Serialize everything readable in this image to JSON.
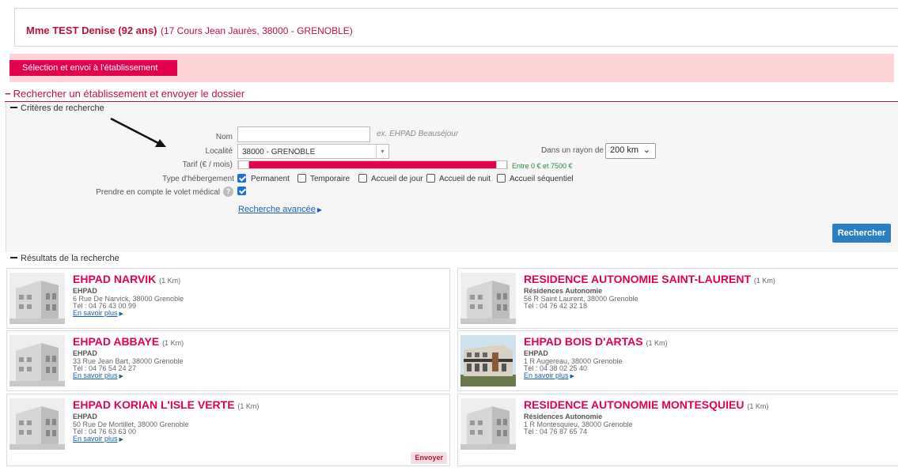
{
  "patient": {
    "name": "Mme TEST Denise (92 ans)",
    "address": "(17 Cours Jean Jaurès, 38000 - GRENOBLE)"
  },
  "nav": {
    "tab_label": "Sélection et envoi à l'établissement"
  },
  "section": {
    "title": "Rechercher un établissement et envoyer le dossier",
    "toggle": "−"
  },
  "criteria": {
    "header": "Critères de recherche",
    "nom_label": "Nom",
    "nom_value": "",
    "nom_hint": "ex. EHPAD Beauséjour",
    "localite_label": "Localité",
    "localite_value": "38000 - GRENOBLE",
    "tarif_label": "Tarif (€ / mois)",
    "tarif_range_text": "Entre 0 € et 7500 €",
    "tarif_min": 0,
    "tarif_max": 7500,
    "rayon_label": "Dans un rayon de",
    "rayon_value": "200 km",
    "type_label": "Type d'hébergement",
    "types": [
      {
        "label": "Permanent",
        "checked": true
      },
      {
        "label": "Temporaire",
        "checked": false
      },
      {
        "label": "Accueil de jour",
        "checked": false
      },
      {
        "label": "Accueil de nuit",
        "checked": false
      },
      {
        "label": "Accueil séquentiel",
        "checked": false
      }
    ],
    "medical_label": "Prendre en compte le volet médical",
    "medical_checked": true,
    "help_symbol": "?",
    "advanced_link": "Recherche avancée",
    "search_button": "Rechercher"
  },
  "results": {
    "header": "Résultats de la recherche",
    "more_label": "En savoir plus",
    "send_label": "Envoyer",
    "items": [
      {
        "name": "EHPAD NARVIK",
        "distance": "(1 Km)",
        "type": "EHPAD",
        "address": "6 Rue De Narvick, 38000 Grenoble",
        "phone": "Tél : 04 76 43 00 99",
        "has_more": true,
        "photo": "building-sketch"
      },
      {
        "name": "RESIDENCE AUTONOMIE SAINT-LAURENT",
        "distance": "(1 Km)",
        "type": "Résidences Autonomie",
        "address": "56 R Saint Laurent, 38000 Grenoble",
        "phone": "Tél : 04 76 42 32 18",
        "has_more": false,
        "photo": "building-sketch"
      },
      {
        "name": "EHPAD ABBAYE",
        "distance": "(1 Km)",
        "type": "EHPAD",
        "address": "33 Rue Jean Bart, 38000 Grenoble",
        "phone": "Tél : 04 76 54 24 27",
        "has_more": true,
        "photo": "building-sketch"
      },
      {
        "name": "EHPAD BOIS D'ARTAS",
        "distance": "(1 Km)",
        "type": "EHPAD",
        "address": "1 R Augereau, 38000 Grenoble",
        "phone": "Tél : 04 38 02 25 40",
        "has_more": true,
        "photo": "building-photo"
      },
      {
        "name": "EHPAD KORIAN L'ISLE VERTE",
        "distance": "(1 Km)",
        "type": "EHPAD",
        "address": "50 Rue De Mortillet, 38000 Grenoble",
        "phone": "Tél : 04 76 63 63 00",
        "has_more": true,
        "photo": "building-sketch",
        "send": true
      },
      {
        "name": "RESIDENCE AUTONOMIE MONTESQUIEU",
        "distance": "(1 Km)",
        "type": "Résidences Autonomie",
        "address": "1 R Montesquieu, 38000 Grenoble",
        "phone": "Tél : 04 76 87 65 74",
        "has_more": false,
        "photo": "building-sketch"
      }
    ]
  },
  "colors": {
    "accent": "#e5004f",
    "header_text": "#c0103c",
    "band": "#fdd3d6",
    "button": "#2a7fc1"
  }
}
